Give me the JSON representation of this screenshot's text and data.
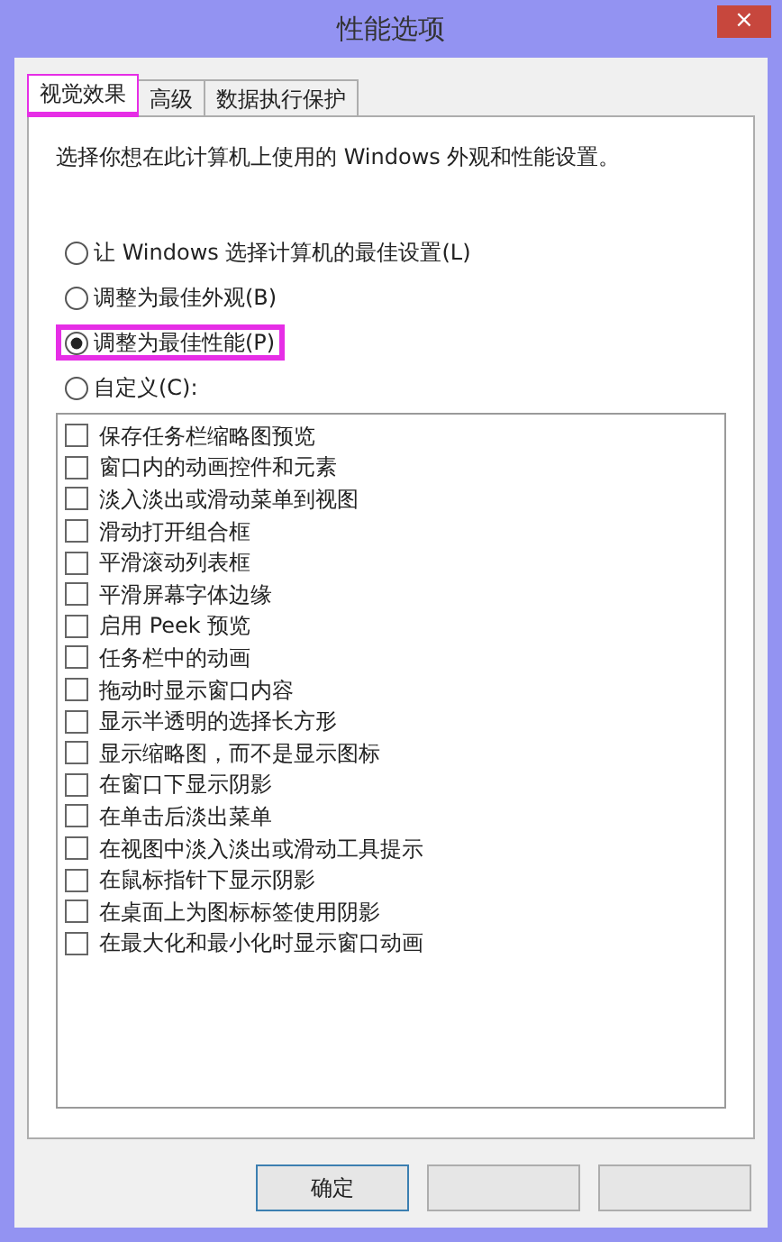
{
  "window": {
    "title": "性能选项",
    "close": "×"
  },
  "tabs": [
    {
      "label": "视觉效果",
      "selected": true,
      "highlighted": true
    },
    {
      "label": "高级",
      "selected": false,
      "highlighted": false
    },
    {
      "label": "数据执行保护",
      "selected": false,
      "highlighted": false
    }
  ],
  "description": "选择你想在此计算机上使用的 Windows 外观和性能设置。",
  "options": [
    {
      "label": "让 Windows 选择计算机的最佳设置(L)",
      "selected": false,
      "highlighted": false
    },
    {
      "label": "调整为最佳外观(B)",
      "selected": false,
      "highlighted": false
    },
    {
      "label": "调整为最佳性能(P)",
      "selected": true,
      "highlighted": true
    },
    {
      "label": "自定义(C):",
      "selected": false,
      "highlighted": false
    }
  ],
  "effects": [
    {
      "label": "保存任务栏缩略图预览",
      "checked": false
    },
    {
      "label": "窗口内的动画控件和元素",
      "checked": false
    },
    {
      "label": "淡入淡出或滑动菜单到视图",
      "checked": false
    },
    {
      "label": "滑动打开组合框",
      "checked": false
    },
    {
      "label": "平滑滚动列表框",
      "checked": false
    },
    {
      "label": "平滑屏幕字体边缘",
      "checked": false
    },
    {
      "label": "启用 Peek 预览",
      "checked": false
    },
    {
      "label": "任务栏中的动画",
      "checked": false
    },
    {
      "label": "拖动时显示窗口内容",
      "checked": false
    },
    {
      "label": "显示半透明的选择长方形",
      "checked": false
    },
    {
      "label": "显示缩略图，而不是显示图标",
      "checked": false
    },
    {
      "label": "在窗口下显示阴影",
      "checked": false
    },
    {
      "label": "在单击后淡出菜单",
      "checked": false
    },
    {
      "label": "在视图中淡入淡出或滑动工具提示",
      "checked": false
    },
    {
      "label": "在鼠标指针下显示阴影",
      "checked": false
    },
    {
      "label": "在桌面上为图标标签使用阴影",
      "checked": false
    },
    {
      "label": "在最大化和最小化时显示窗口动画",
      "checked": false
    }
  ],
  "buttons": [
    {
      "kind": "text",
      "label": "确定"
    },
    {
      "kind": "blank"
    },
    {
      "kind": "blank"
    }
  ]
}
